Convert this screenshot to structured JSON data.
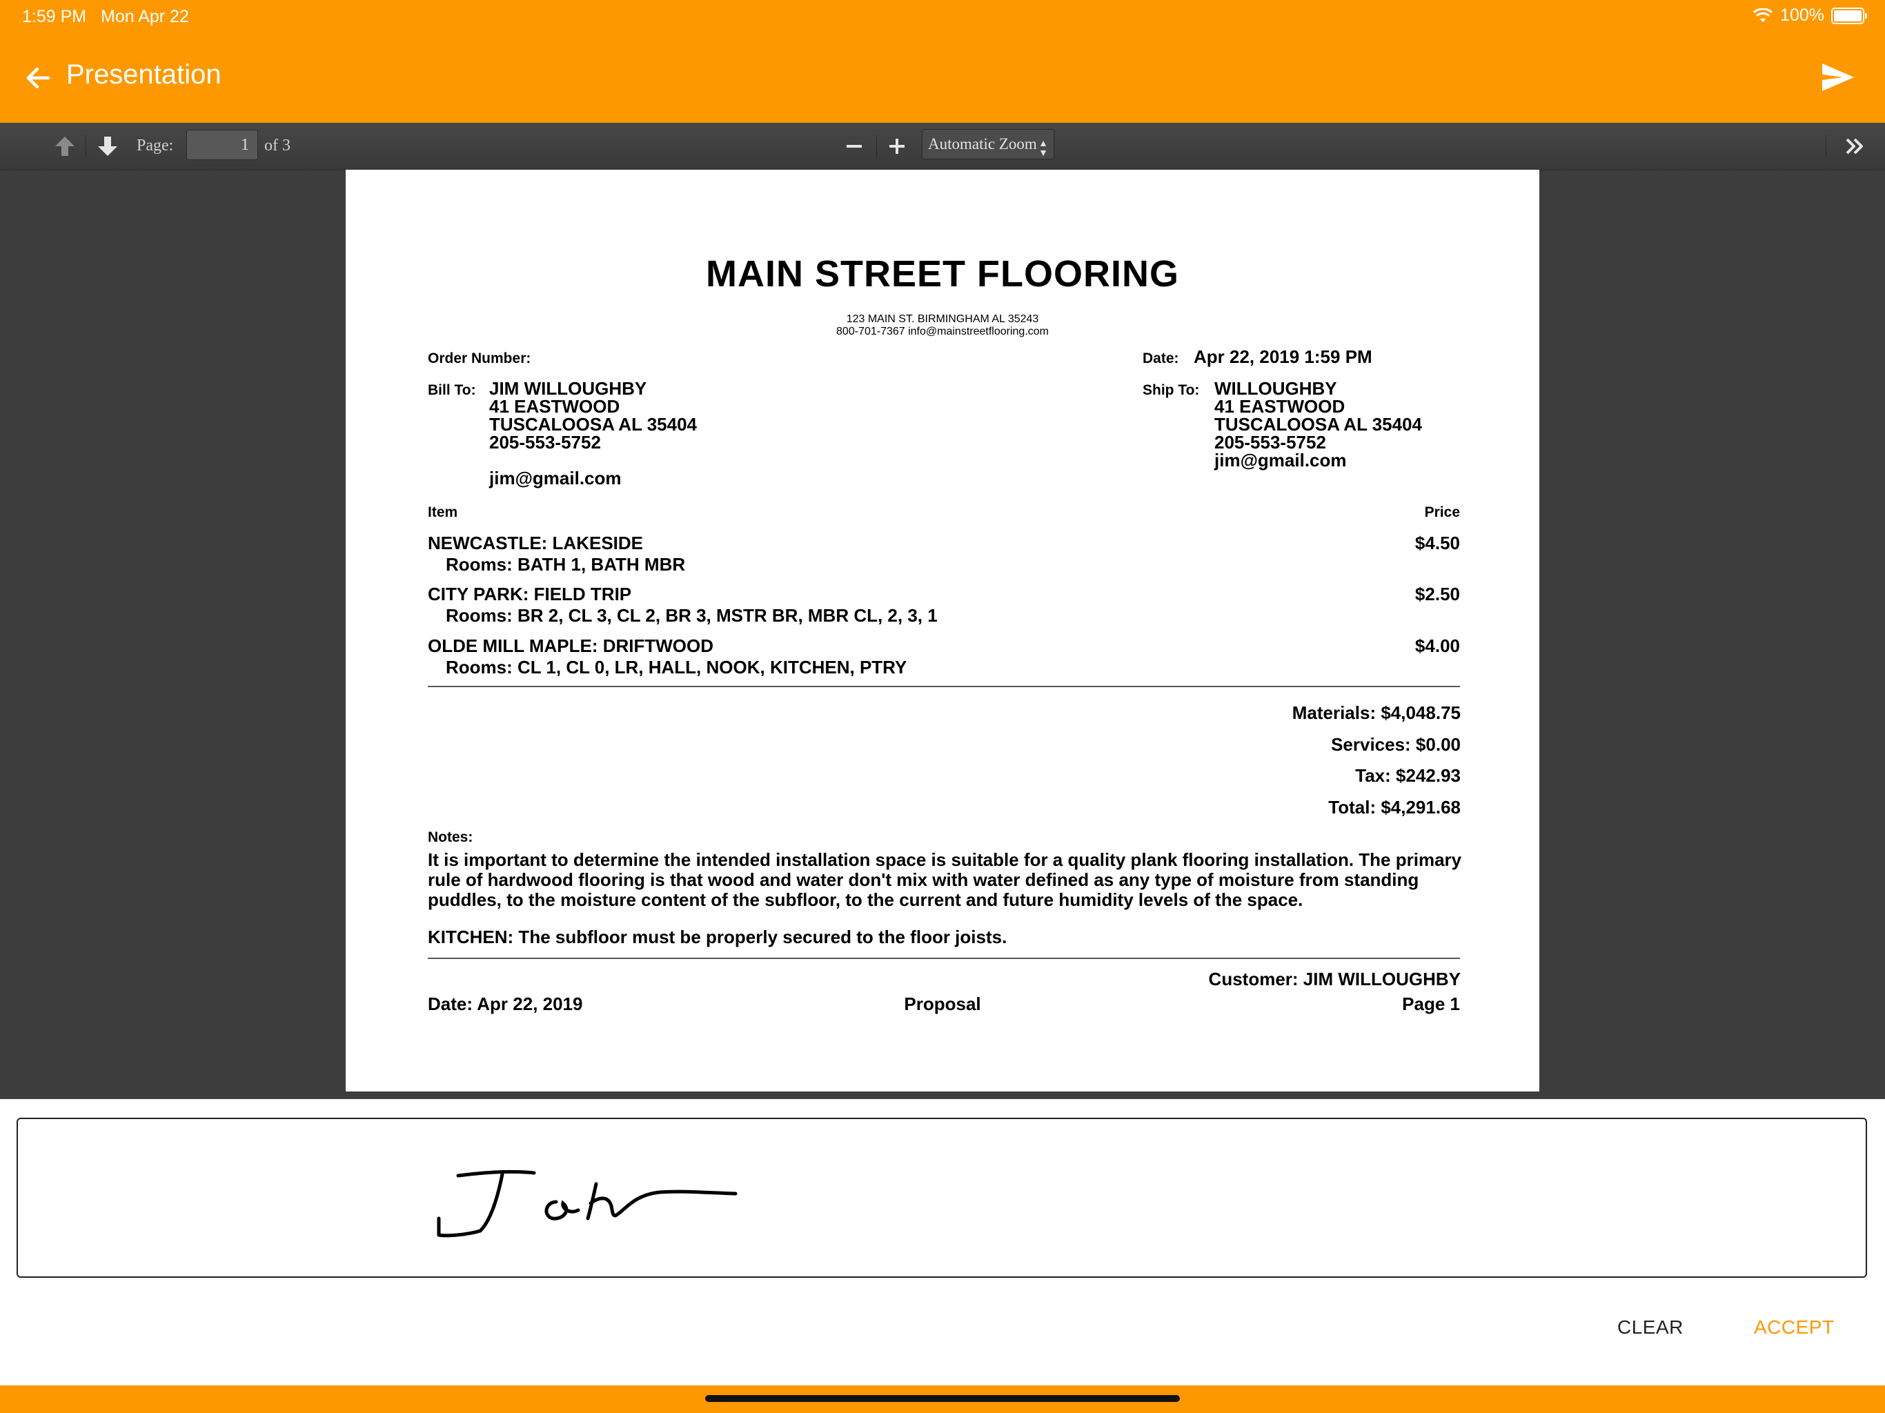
{
  "status_bar": {
    "time": "1:59 PM",
    "date": "Mon Apr 22",
    "battery": "100%"
  },
  "app_bar": {
    "title": "Presentation",
    "back_icon": "arrow-left-icon",
    "send_icon": "send-icon",
    "color": "#fe9800"
  },
  "viewer_toolbar": {
    "page_label": "Page:",
    "page_value": "1",
    "page_of": "of 3",
    "zoom_value": "Automatic Zoom",
    "icons": [
      "arrow-up-icon",
      "arrow-down-icon",
      "zoom-out-icon",
      "zoom-in-icon",
      "double-chevron-right-icon"
    ]
  },
  "document": {
    "company": "MAIN STREET FLOORING",
    "address": "123 MAIN ST. BIRMINGHAM AL 35243",
    "contact": "800-701-7367 info@mainstreetflooring.com",
    "order_number_label": "Order Number:",
    "date_label": "Date:",
    "date_value": "Apr 22, 2019 1:59 PM",
    "bill_to_label": "Bill To:",
    "bill_to": [
      "JIM WILLOUGHBY",
      "41 EASTWOOD",
      "TUSCALOOSA AL 35404",
      "205-553-5752"
    ],
    "bill_to_email": "jim@gmail.com",
    "ship_to_label": "Ship To:",
    "ship_to": [
      "WILLOUGHBY",
      "41 EASTWOOD",
      "TUSCALOOSA AL 35404",
      "205-553-5752",
      "jim@gmail.com"
    ],
    "item_header": "Item",
    "price_header": "Price",
    "items": [
      {
        "name": "NEWCASTLE: LAKESIDE",
        "rooms": "Rooms: BATH 1, BATH MBR",
        "price": "$4.50"
      },
      {
        "name": "CITY PARK: FIELD TRIP",
        "rooms": "Rooms: BR 2, CL 3, CL 2, BR 3, MSTR BR, MBR CL, 2, 3, 1",
        "price": "$2.50"
      },
      {
        "name": "OLDE MILL MAPLE: DRIFTWOOD",
        "rooms": "Rooms: CL 1, CL 0, LR, HALL, NOOK, KITCHEN, PTRY",
        "price": "$4.00"
      }
    ],
    "totals": {
      "materials": "Materials:  $4,048.75",
      "services": "Services:  $0.00",
      "tax": "Tax:  $242.93",
      "total": "Total:  $4,291.68"
    },
    "notes_label": "Notes:",
    "notes_text": "It is important to determine the intended installation space is suitable for a quality plank flooring installation. The primary rule of hardwood flooring is that wood and water don't mix with water defined as any type of moisture from standing puddles, to the moisture content of the subfloor, to the current and future humidity levels of the space.",
    "kitchen_note": "KITCHEN: The subfloor must be properly secured to the floor joists.",
    "footer": {
      "customer": "Customer: JIM WILLOUGHBY",
      "date": "Date: Apr 22, 2019",
      "center": "Proposal",
      "page": "Page 1"
    }
  },
  "signature": {
    "clear_label": "CLEAR",
    "accept_label": "ACCEPT"
  }
}
